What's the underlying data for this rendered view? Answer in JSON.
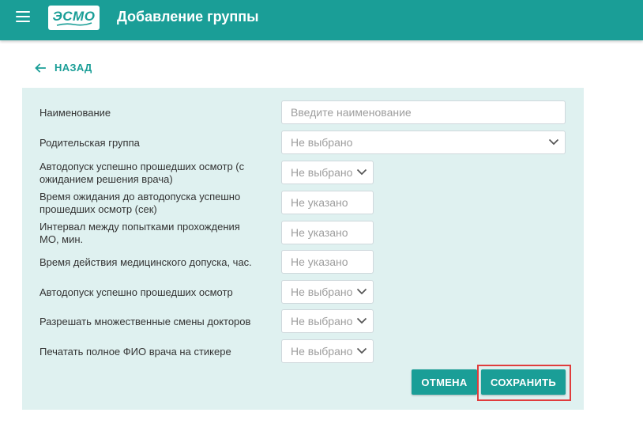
{
  "header": {
    "title": "Добавление группы",
    "logo_text": "ЭСМО",
    "menu_icon": "hamburger-menu-icon"
  },
  "nav": {
    "back_label": "НАЗАД",
    "back_icon": "arrow-left-icon"
  },
  "form": {
    "fields": [
      {
        "label": "Наименование",
        "placeholder": "Введите наименование",
        "kind": "text"
      },
      {
        "label": "Родительская группа",
        "value": "Не выбрано",
        "kind": "select"
      },
      {
        "label": "Автодопуск успешно прошедших осмотр (с ожиданием решения врача)",
        "value": "Не выбрано",
        "kind": "select"
      },
      {
        "label": "Время ожидания до автодопуска успешно прошедших осмотр (сек)",
        "placeholder": "Не указано",
        "kind": "number"
      },
      {
        "label": "Интервал между попытками прохождения МО, мин.",
        "placeholder": "Не указано",
        "kind": "number"
      },
      {
        "label": "Время действия медицинского допуска, час.",
        "placeholder": "Не указано",
        "kind": "number"
      },
      {
        "label": "Автодопуск успешно прошедших осмотр",
        "value": "Не выбрано",
        "kind": "select"
      },
      {
        "label": "Разрешать множественные смены докторов",
        "value": "Не выбрано",
        "kind": "select"
      },
      {
        "label": "Печатать полное ФИО врача на стикере",
        "value": "Не выбрано",
        "kind": "select"
      }
    ],
    "cancel_label": "ОТМЕНА",
    "save_label": "СОХРАНИТЬ"
  },
  "colors": {
    "accent": "#1a9e97",
    "panel_bg": "#dff1f0",
    "highlight": "#e03c3c"
  }
}
